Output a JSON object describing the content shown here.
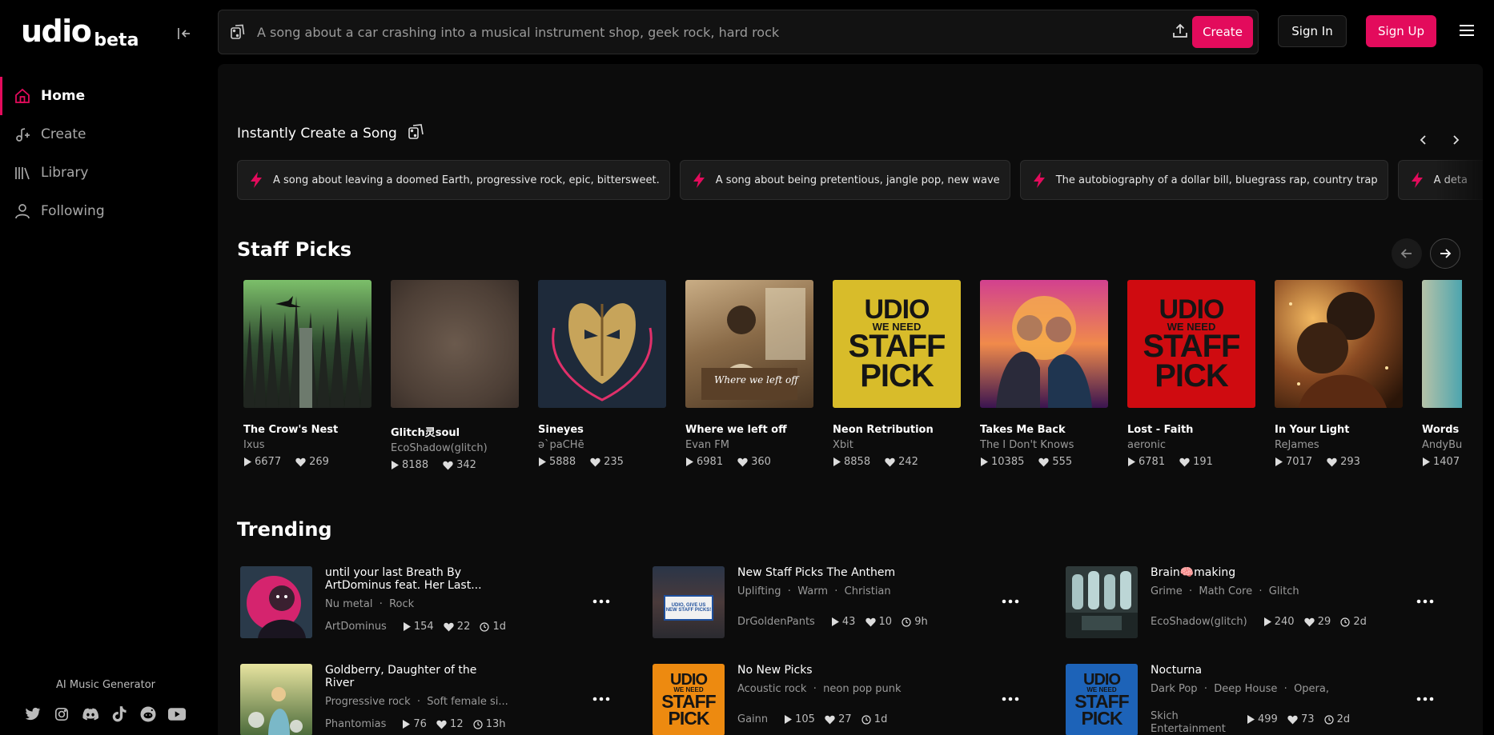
{
  "sidebar": {
    "logo": "udio",
    "logo_suffix": "beta",
    "nav": [
      {
        "label": "Home",
        "icon": "home-icon",
        "active": true
      },
      {
        "label": "Create",
        "icon": "music-note-plus-icon",
        "active": false
      },
      {
        "label": "Library",
        "icon": "library-icon",
        "active": false
      },
      {
        "label": "Following",
        "icon": "user-icon",
        "active": false
      }
    ],
    "footer_label": "AI Music Generator",
    "socials": [
      "twitter-icon",
      "instagram-icon",
      "discord-icon",
      "tiktok-icon",
      "reddit-icon",
      "youtube-icon"
    ]
  },
  "topbar": {
    "search_placeholder": "A song about a car crashing into a musical instrument shop, geek rock, hard rock",
    "create_label": "Create",
    "signin_label": "Sign In",
    "signup_label": "Sign Up"
  },
  "instant": {
    "title": "Instantly Create a Song",
    "prompts": [
      "A song about leaving a doomed Earth, progressive rock, epic, bittersweet.",
      "A song about being pretentious, jangle pop, new wave",
      "The autobiography of a dollar bill, bluegrass rap, country trap",
      "A deta"
    ]
  },
  "staff_picks": {
    "title": "Staff Picks",
    "items": [
      {
        "title": "The Crow's Nest",
        "artist": "Ixus",
        "plays": "6677",
        "likes": "269"
      },
      {
        "title": "Glitch灵soul",
        "artist": "EcoShadow(glitch)",
        "plays": "8188",
        "likes": "342"
      },
      {
        "title": "Sineyes",
        "artist": "ə`paCHē",
        "plays": "5888",
        "likes": "235"
      },
      {
        "title": "Where we left off",
        "artist": "Evan FM",
        "plays": "6981",
        "likes": "360"
      },
      {
        "title": "Neon Retribution",
        "artist": "Xbit",
        "plays": "8858",
        "likes": "242"
      },
      {
        "title": "Takes Me Back",
        "artist": "The I Don't Knows",
        "plays": "10385",
        "likes": "555"
      },
      {
        "title": "Lost - Faith",
        "artist": "aeronic",
        "plays": "6781",
        "likes": "191"
      },
      {
        "title": "In Your Light",
        "artist": "ReJames",
        "plays": "7017",
        "likes": "293"
      },
      {
        "title": "Words T",
        "artist": "AndyBu",
        "plays": "1407",
        "likes": ""
      }
    ],
    "staff_cover_text": {
      "line1": "UDIO",
      "line2": "WE NEED",
      "line3a": "STAFF",
      "line3b": "PICK"
    },
    "cover_script_text": "Where we left off"
  },
  "trending": {
    "title": "Trending",
    "items": [
      {
        "title": "until your last Breath By ArtDominus feat. Her Last...",
        "tags": [
          "Nu metal",
          "Rock"
        ],
        "artist": "ArtDominus",
        "plays": "154",
        "likes": "22",
        "age": "1d"
      },
      {
        "title": "New Staff Picks The Anthem",
        "tags": [
          "Uplifting",
          "Warm",
          "Christian"
        ],
        "artist": "DrGoldenPants",
        "plays": "43",
        "likes": "10",
        "age": "9h"
      },
      {
        "title": "Brain🧠making",
        "tags": [
          "Grime",
          "Math Core",
          "Glitch"
        ],
        "artist": "EcoShadow(glitch)",
        "plays": "240",
        "likes": "29",
        "age": "2d"
      },
      {
        "title": "Goldberry, Daughter of the River",
        "tags": [
          "Progressive rock",
          "Soft female si..."
        ],
        "artist": "Phantomias",
        "plays": "76",
        "likes": "12",
        "age": "13h"
      },
      {
        "title": "No New Picks",
        "tags": [
          "Acoustic rock",
          "neon pop punk"
        ],
        "artist": "Gainn",
        "plays": "105",
        "likes": "27",
        "age": "1d"
      },
      {
        "title": "Nocturna",
        "tags": [
          "Dark Pop",
          "Deep House",
          "Opera,"
        ],
        "artist": "Skich Entertainment",
        "plays": "499",
        "likes": "73",
        "age": "2d"
      }
    ],
    "sign_text": "UDIO, GIVE US NEW STAFF PICKS!"
  },
  "colors": {
    "accent": "#e30b5c",
    "panel": "#0c0c0c",
    "chip": "#1b1b1b"
  }
}
